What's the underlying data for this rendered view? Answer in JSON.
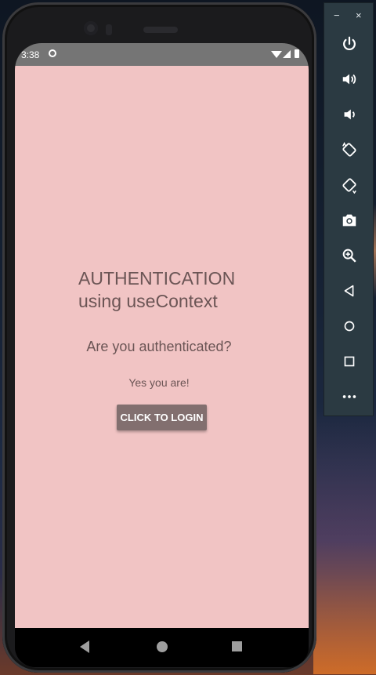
{
  "status_bar": {
    "time": "3:38"
  },
  "app": {
    "title": "AUTHENTICATION\nusing useContext",
    "question": "Are you authenticated?",
    "answer": "Yes you are!",
    "button_label": "CLICK TO LOGIN"
  },
  "toolbar": {
    "minimize": "−",
    "close": "×",
    "buttons": [
      "power-icon",
      "volume-up-icon",
      "volume-down-icon",
      "rotate-left-icon",
      "rotate-right-icon",
      "camera-icon",
      "zoom-icon",
      "back-icon",
      "home-icon",
      "overview-icon",
      "more-icon"
    ]
  },
  "colors": {
    "app_background": "#f1c4c4",
    "text": "#6b5555",
    "button": "#826f6f",
    "status_bar": "#757575",
    "toolbar": "#2b3a42"
  }
}
